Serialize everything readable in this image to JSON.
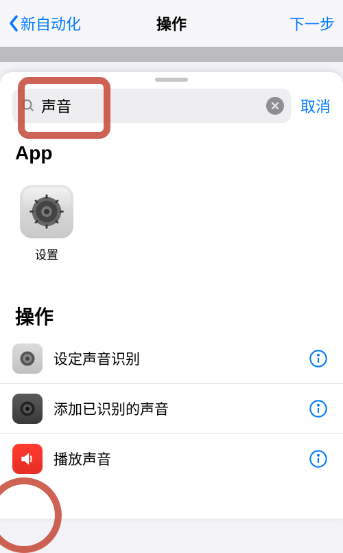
{
  "header": {
    "back_label": "新自动化",
    "title": "操作",
    "next_label": "下一步"
  },
  "search": {
    "value": "声音",
    "cancel_label": "取消"
  },
  "sections": {
    "apps_title": "App",
    "actions_title": "操作"
  },
  "apps": [
    {
      "label": "设置"
    }
  ],
  "actions": [
    {
      "label": "设定声音识别",
      "icon_variant": "gray"
    },
    {
      "label": "添加已识别的声音",
      "icon_variant": "dark"
    },
    {
      "label": "播放声音",
      "icon_variant": "red"
    }
  ]
}
